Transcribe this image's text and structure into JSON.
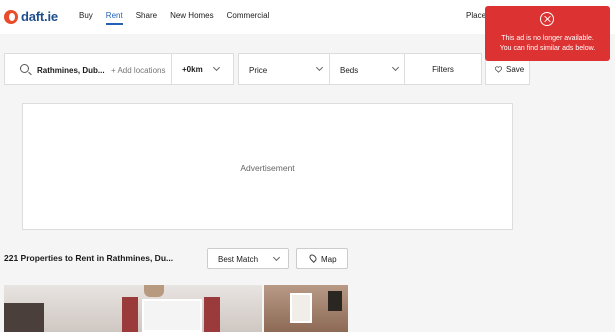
{
  "header": {
    "logo_text": "daft.ie",
    "nav": [
      "Buy",
      "Rent",
      "Share",
      "New Homes",
      "Commercial"
    ],
    "active_nav": "Rent",
    "place_ad": "Place ad"
  },
  "toast": {
    "line1": "This ad is no longer available.",
    "line2": "You can find similar ads below.",
    "color": "#dc3232"
  },
  "filters": {
    "search_value": "Rathmines, Dub...",
    "add_locations": "+ Add locations",
    "radius": "+0km",
    "price": "Price",
    "beds": "Beds",
    "filters": "Filters",
    "save": "Save"
  },
  "ad": {
    "label": "Advertisement"
  },
  "results": {
    "title": "221 Properties to Rent in Rathmines, Du...",
    "sort": "Best Match",
    "map": "Map"
  },
  "colors": {
    "accent": "#2261b6",
    "brand": "#e94b2b"
  }
}
